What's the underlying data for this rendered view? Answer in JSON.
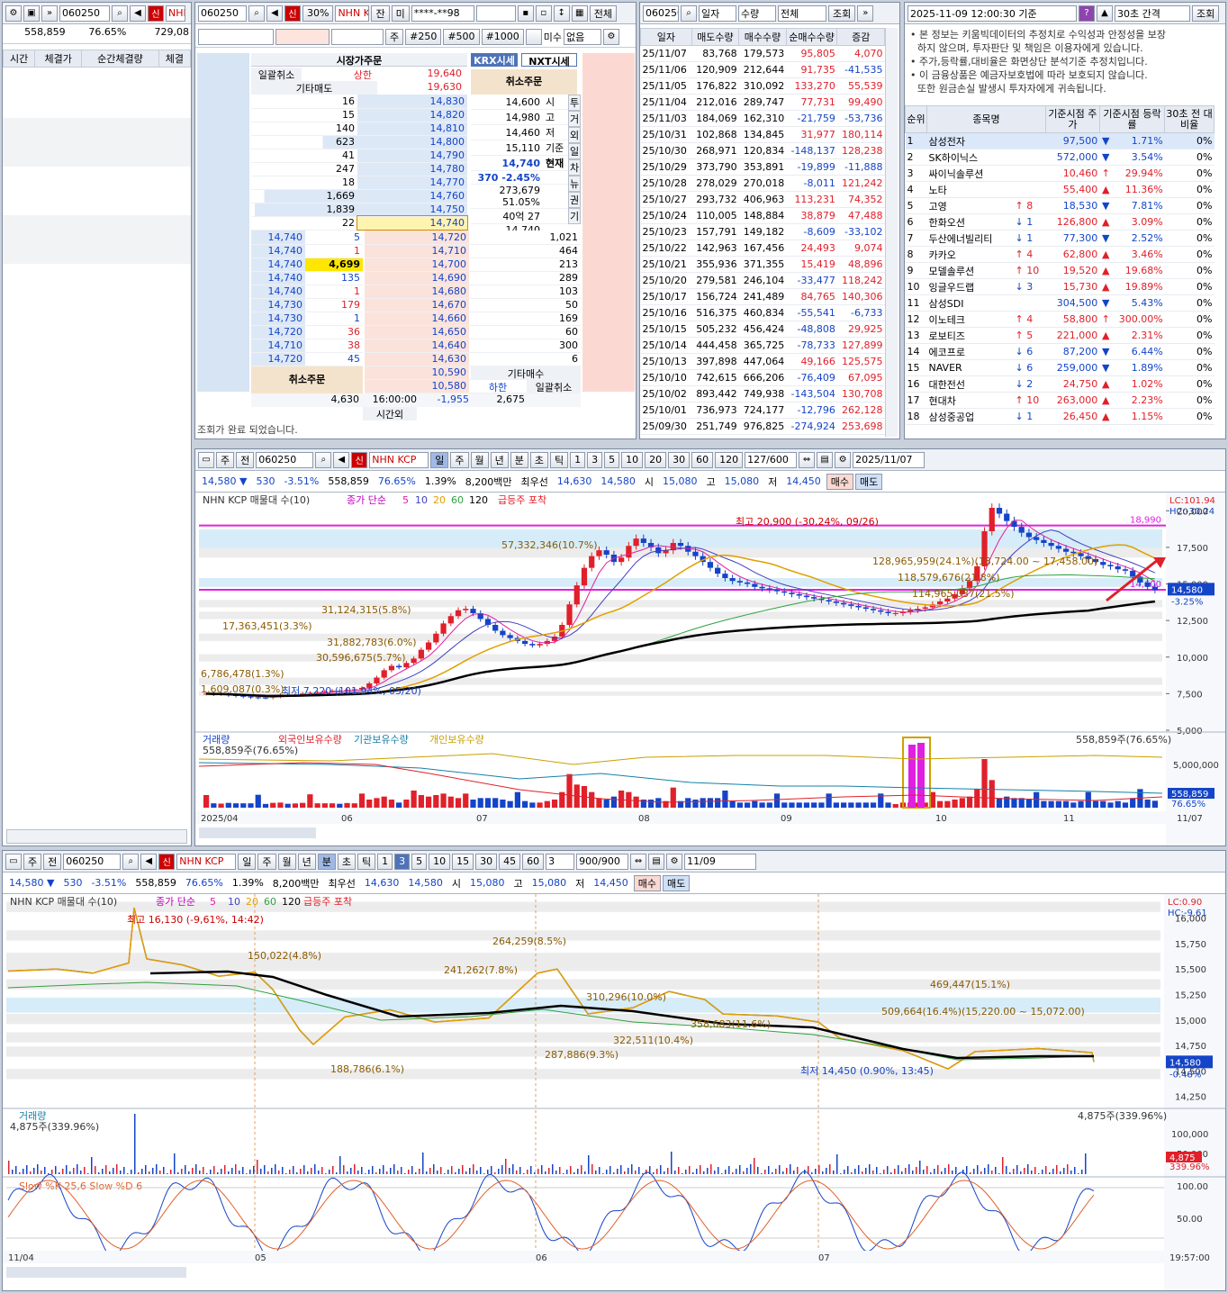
{
  "ticker": {
    "code": "060250",
    "name": "NHN KCP",
    "short": "NHN",
    "badge": "신"
  },
  "summary": {
    "volume": "558,859",
    "ratio": "76.65%",
    "last": "729,08"
  },
  "left": {
    "cols": [
      "시간",
      "체결가",
      "순간체결량",
      "체결"
    ]
  },
  "order": {
    "toolbar": {
      "code": "060250",
      "pct": "30%",
      "name": "NHN KI",
      "jan": "잔",
      "mi": "미",
      "acct": "****-**98",
      "all": "전체"
    },
    "row2": {
      "ju": "주",
      "b1": "#250",
      "b2": "#500",
      "b3": "#1000",
      "misu": "미수",
      "none": "없음"
    },
    "hdr": "시장가주문",
    "cancelAll": "일괄취소",
    "upper_label": "상한",
    "upper": "19,640",
    "other_sell": "기타매도",
    "top_price": "19,630",
    "krx": "KRX시세",
    "nxt": "NXT시세",
    "cancel_order": "취소주문",
    "asks": [
      [
        "16",
        "14,830"
      ],
      [
        "15",
        "14,820"
      ],
      [
        "140",
        "14,810"
      ],
      [
        "623",
        "14,800"
      ],
      [
        "41",
        "14,790"
      ],
      [
        "247",
        "14,780"
      ],
      [
        "18",
        "14,770"
      ],
      [
        "1,669",
        "14,760"
      ],
      [
        "1,839",
        "14,750"
      ],
      [
        "22",
        "14,740"
      ]
    ],
    "info": [
      [
        "14,600",
        "시"
      ],
      [
        "14,980",
        "고"
      ],
      [
        "14,460",
        "저"
      ],
      [
        "15,110",
        "기준"
      ],
      [
        "14,740",
        "현재"
      ],
      [
        "370 -2.45%",
        ""
      ],
      [
        "273,679 51.05%",
        ""
      ],
      [
        "40억 27",
        ""
      ],
      [
        "14,740 -2.45%",
        ""
      ],
      [
        "4,699",
        "예상"
      ]
    ],
    "side_tabs": [
      "투",
      "거",
      "외",
      "일",
      "차",
      "뉴",
      "권",
      "기"
    ],
    "ticks": [
      [
        "14,740",
        "5"
      ],
      [
        "14,740",
        "1"
      ],
      [
        "14,740",
        "4,699"
      ],
      [
        "14,740",
        "135"
      ],
      [
        "14,740",
        "1"
      ],
      [
        "14,730",
        "179"
      ],
      [
        "14,730",
        "1"
      ],
      [
        "14,720",
        "36"
      ],
      [
        "14,710",
        "38"
      ],
      [
        "14,720",
        "45"
      ]
    ],
    "bids": [
      [
        "14,720",
        "1,021"
      ],
      [
        "14,710",
        "464"
      ],
      [
        "14,700",
        "213"
      ],
      [
        "14,690",
        "289"
      ],
      [
        "14,680",
        "103"
      ],
      [
        "14,670",
        "50"
      ],
      [
        "14,660",
        "169"
      ],
      [
        "14,650",
        "60"
      ],
      [
        "14,640",
        "300"
      ],
      [
        "14,630",
        "6"
      ],
      [
        "10,590",
        ""
      ],
      [
        "10,580",
        ""
      ]
    ],
    "other_buy": "기타매수",
    "lower_label": "하한",
    "cancelAll2": "일괄취소",
    "foot": [
      "4,630",
      "16:00:00",
      "-1,955",
      "2,675"
    ],
    "after": "시간외",
    "status": "조회가 완료 되었습니다."
  },
  "daily": {
    "toolbar": {
      "code": "060250",
      "date": "일자",
      "qty": "수량",
      "all": "전체",
      "query": "조회"
    },
    "cols": [
      "일자",
      "매도수량",
      "매수수량",
      "순매수수량",
      "증감"
    ],
    "rows": [
      [
        "25/11/07",
        "83,768",
        "179,573",
        "95,805",
        "4,070"
      ],
      [
        "25/11/06",
        "120,909",
        "212,644",
        "91,735",
        "-41,535"
      ],
      [
        "25/11/05",
        "176,822",
        "310,092",
        "133,270",
        "55,539"
      ],
      [
        "25/11/04",
        "212,016",
        "289,747",
        "77,731",
        "99,490"
      ],
      [
        "25/11/03",
        "184,069",
        "162,310",
        "-21,759",
        "-53,736"
      ],
      [
        "25/10/31",
        "102,868",
        "134,845",
        "31,977",
        "180,114"
      ],
      [
        "25/10/30",
        "268,971",
        "120,834",
        "-148,137",
        "128,238"
      ],
      [
        "25/10/29",
        "373,790",
        "353,891",
        "-19,899",
        "-11,888"
      ],
      [
        "25/10/28",
        "278,029",
        "270,018",
        "-8,011",
        "121,242"
      ],
      [
        "25/10/27",
        "293,732",
        "406,963",
        "113,231",
        "74,352"
      ],
      [
        "25/10/24",
        "110,005",
        "148,884",
        "38,879",
        "47,488"
      ],
      [
        "25/10/23",
        "157,791",
        "149,182",
        "-8,609",
        "-33,102"
      ],
      [
        "25/10/22",
        "142,963",
        "167,456",
        "24,493",
        "9,074"
      ],
      [
        "25/10/21",
        "355,936",
        "371,355",
        "15,419",
        "48,896"
      ],
      [
        "25/10/20",
        "279,581",
        "246,104",
        "-33,477",
        "118,242"
      ],
      [
        "25/10/17",
        "156,724",
        "241,489",
        "84,765",
        "140,306"
      ],
      [
        "25/10/16",
        "516,375",
        "460,834",
        "-55,541",
        "-6,733"
      ],
      [
        "25/10/15",
        "505,232",
        "456,424",
        "-48,808",
        "29,925"
      ],
      [
        "25/10/14",
        "444,458",
        "365,725",
        "-78,733",
        "127,899"
      ],
      [
        "25/10/13",
        "397,898",
        "447,064",
        "49,166",
        "125,575"
      ],
      [
        "25/10/10",
        "742,615",
        "666,206",
        "-76,409",
        "67,095"
      ],
      [
        "25/10/02",
        "893,442",
        "749,938",
        "-143,504",
        "130,708"
      ],
      [
        "25/10/01",
        "736,973",
        "724,177",
        "-12,796",
        "262,128"
      ],
      [
        "25/09/30",
        "251,749",
        "976,825",
        "-274,924",
        "253,698"
      ]
    ]
  },
  "rank": {
    "time": "2025-11-09 12:00:30 기준",
    "interval": "30초 간격",
    "query": "조회",
    "notes": [
      "본 정보는 키움빅데이터의 추정치로 수익성과 안정성을 보장",
      "하지 않으며, 투자판단 및 책임은 이용자에게 있습니다.",
      "주가,등락률,대비율은 화면상단 분석기준 추정치입니다.",
      "이 금융상품은 예금자보호법에 따라 보호되지 않습니다.",
      "또한 원금손실 발생시 투자자에게 귀속됩니다."
    ],
    "cols": [
      "순위",
      "종목명",
      "기준시점 주가",
      "기준시점 등락률",
      "30초 전 대비율"
    ],
    "rows": [
      [
        "1",
        "삼성전자",
        "",
        "97,500",
        "▼",
        "1.71%",
        "0%"
      ],
      [
        "2",
        "SK하이닉스",
        "",
        "572,000",
        "▼",
        "3.54%",
        "0%"
      ],
      [
        "3",
        "싸이닉솔루션",
        "",
        "10,460",
        "↑",
        "29.94%",
        "0%"
      ],
      [
        "4",
        "노타",
        "",
        "55,400",
        "▲",
        "11.36%",
        "0%"
      ],
      [
        "5",
        "고영",
        "↑ 8",
        "18,530",
        "▼",
        "7.81%",
        "0%"
      ],
      [
        "6",
        "한화오션",
        "↓ 1",
        "126,800",
        "▲",
        "3.09%",
        "0%"
      ],
      [
        "7",
        "두산에너빌리티",
        "↓ 1",
        "77,300",
        "▼",
        "2.52%",
        "0%"
      ],
      [
        "8",
        "카카오",
        "↑ 4",
        "62,800",
        "▲",
        "3.46%",
        "0%"
      ],
      [
        "9",
        "모델솔루션",
        "↑ 10",
        "19,520",
        "▲",
        "19.68%",
        "0%"
      ],
      [
        "10",
        "잉글우드랩",
        "↓ 3",
        "15,730",
        "▲",
        "19.89%",
        "0%"
      ],
      [
        "11",
        "삼성SDI",
        "",
        "304,500",
        "▼",
        "5.43%",
        "0%"
      ],
      [
        "12",
        "이노테크",
        "↑ 4",
        "58,800",
        "↑",
        "300.00%",
        "0%"
      ],
      [
        "13",
        "로보티즈",
        "↑ 5",
        "221,000",
        "▲",
        "2.31%",
        "0%"
      ],
      [
        "14",
        "에코프로",
        "↓ 6",
        "87,200",
        "▼",
        "6.44%",
        "0%"
      ],
      [
        "15",
        "NAVER",
        "↓ 6",
        "259,000",
        "▼",
        "1.89%",
        "0%"
      ],
      [
        "16",
        "대한전선",
        "↓ 2",
        "24,750",
        "▲",
        "1.02%",
        "0%"
      ],
      [
        "17",
        "현대차",
        "↑ 10",
        "263,000",
        "▲",
        "2.23%",
        "0%"
      ],
      [
        "18",
        "삼성중공업",
        "↓ 1",
        "26,450",
        "▲",
        "1.15%",
        "0%"
      ]
    ]
  },
  "chart1": {
    "toolbar": {
      "ju": "주",
      "jeon": "전",
      "code": "060250",
      "name": "NHN KCP",
      "periods": [
        "일",
        "주",
        "월",
        "년",
        "분",
        "초",
        "틱"
      ],
      "nums": [
        "1",
        "3",
        "5",
        "10",
        "20",
        "30",
        "60",
        "120"
      ],
      "count": "127/600",
      "date": "2025/11/07"
    },
    "quote": {
      "price": "14,580",
      "change": "530",
      "pct": "-3.51%",
      "vol": "558,859",
      "vr": "76.65%",
      "turn": "1.39%",
      "amount": "8,200백만",
      "best": "최우선",
      "ask": "14,630",
      "bid": "14,580",
      "open_l": "시",
      "open": "15,080",
      "high_l": "고",
      "high": "15,080",
      "low_l": "저",
      "low": "14,450",
      "buy": "매수",
      "sell": "매도"
    },
    "legend": {
      "name": "NHN KCP 매물대 수(10)",
      "ma": "종가 단순",
      "ma_p": [
        "5",
        "10",
        "20",
        "60",
        "120"
      ],
      "surge": "급등주 포착"
    },
    "lc": "LC:101.94",
    "hc": "HC:-30.24",
    "y_ticks": [
      "20,000",
      "17,500",
      "15,000",
      "12,500",
      "10,000",
      "7,500",
      "5,000"
    ],
    "hline_top": "18,990",
    "hline_bot": "14,600",
    "cur_price": "14,580",
    "cur_pct": "-3.25%",
    "annotations": {
      "high": "최고 20,900 (-30,24%, 09/26)",
      "low": "최저 7,220 (101.94%, 05/20)",
      "vp1": "57,332,346(10.7%)",
      "vp2": "31,124,315(5.8%)",
      "vp3": "17,363,451(3.3%)",
      "vp4": "31,882,783(6.0%)",
      "vp5": "30,596,675(5.7%)",
      "vp6": "6,786,478(1.3%)",
      "vp7": "1,609,087(0.3%)",
      "vp8": "128,965,959(24.1%)(18,724.00 ~ 17,458.00)",
      "vp9": "118,579,676(21.8%)",
      "vp10": "114,965,037(21.5%)"
    },
    "vol_legend": [
      "거래량",
      "외국인보유수량",
      "기관보유수량",
      "개인보유수량"
    ],
    "vol_label": "558,859주(76.65%)",
    "vol_ticks": [
      "5,000,000"
    ],
    "vol_cur": "558,859",
    "vol_cur_pct": "76.65%",
    "x_labels": [
      "2025/04",
      "06",
      "07",
      "08",
      "09",
      "10",
      "11",
      "11/07"
    ],
    "chart_data": {
      "type": "candlestick",
      "title": "",
      "x_range": [
        "2025/04",
        "2025/11/07"
      ],
      "ylim": [
        5000,
        21000
      ],
      "closes": [
        7500,
        7450,
        7480,
        7400,
        7350,
        7300,
        7250,
        7230,
        7220,
        7300,
        7400,
        7380,
        7420,
        7500,
        7550,
        7600,
        7650,
        7700,
        7680,
        7750,
        7800,
        7900,
        8200,
        8600,
        9100,
        9400,
        9300,
        9600,
        9900,
        10500,
        11000,
        11600,
        12300,
        12800,
        13200,
        13300,
        13000,
        12600,
        12200,
        11800,
        11500,
        11300,
        11100,
        10900,
        10800,
        10900,
        11100,
        11400,
        12200,
        13600,
        14900,
        16100,
        16900,
        17300,
        17000,
        16500,
        16800,
        17600,
        18100,
        17800,
        17500,
        17100,
        17300,
        17800,
        17600,
        17200,
        16900,
        16500,
        16100,
        15700,
        15400,
        15200,
        15100,
        15000,
        14800,
        14700,
        14600,
        14500,
        14400,
        14300,
        14200,
        14100,
        14000,
        13900,
        13800,
        13700,
        13600,
        13500,
        13400,
        13300,
        13200,
        13100,
        13000,
        13000,
        13100,
        13200,
        13300,
        13400,
        13600,
        13800,
        14000,
        14300,
        14700,
        15200,
        16200,
        18600,
        20200,
        19800,
        19300,
        18900,
        18500,
        18200,
        18000,
        17800,
        17600,
        17400,
        17200,
        17100,
        16900,
        16700,
        16500,
        16300,
        16200,
        16000,
        15900,
        15500,
        15100,
        14800,
        14580
      ]
    }
  },
  "chart2": {
    "toolbar": {
      "ju": "주",
      "jeon": "전",
      "code": "060250",
      "name": "NHN KCP",
      "periods": [
        "일",
        "주",
        "월",
        "년",
        "분",
        "초",
        "틱"
      ],
      "nums": [
        "1",
        "3",
        "5",
        "10",
        "15",
        "30",
        "45",
        "60"
      ],
      "n": "3",
      "count": "900/900",
      "date": "11/09"
    },
    "quote": {
      "price": "14,580",
      "change": "530",
      "pct": "-3.51%",
      "vol": "558,859",
      "vr": "76.65%",
      "turn": "1.39%",
      "amount": "8,200백만",
      "best": "최우선",
      "ask": "14,630",
      "bid": "14,580",
      "open_l": "시",
      "open": "15,080",
      "high_l": "고",
      "high": "15,080",
      "low_l": "저",
      "low": "14,450",
      "buy": "매수",
      "sell": "매도"
    },
    "legend": {
      "name": "NHN KCP 매물대 수(10)",
      "ma": "종가 단순",
      "ma_p": [
        "5",
        "10",
        "20",
        "60",
        "120"
      ],
      "surge": "급등주 포착"
    },
    "lc": "LC:0.90",
    "hc": "HC:-9.61",
    "y_ticks": [
      "16,000",
      "15,750",
      "15,500",
      "15,250",
      "15,000",
      "14,750",
      "14,500",
      "14,250"
    ],
    "cur_price": "14,580",
    "cur_pct": "-0.48%",
    "annotations": {
      "high": "최고 16,130 (-9,61%, 14:42)",
      "low": "최저 14,450 (0.90%, 13:45)",
      "vp1": "264,259(8.5%)",
      "vp2": "150,022(4.8%)",
      "vp3": "241,262(7.8%)",
      "vp4": "469,447(15.1%)",
      "vp5": "310,296(10.0%)",
      "vp6": "509,664(16.4%)(15,220.00 ~ 15,072.00)",
      "vp7": "358,683(11.6%)",
      "vp8": "322,511(10.4%)",
      "vp9": "287,886(9.3%)",
      "vp10": "188,786(6.1%)"
    },
    "vol_legend": "거래량",
    "vol_label": "4,875주(339.96%)",
    "vol_right": "4,875주(339.96%)",
    "vol_ticks": [
      "100,000",
      "50,000"
    ],
    "vol_cur": "4,875",
    "vol_cur_pct": "339.96%",
    "stoch_legend": "Slow %K 25,6  Slow %D 6",
    "stoch_ticks": [
      "100.00",
      "50.00"
    ],
    "x_labels": [
      "11/04",
      "05",
      "06",
      "07"
    ],
    "time": "19:57:00"
  }
}
